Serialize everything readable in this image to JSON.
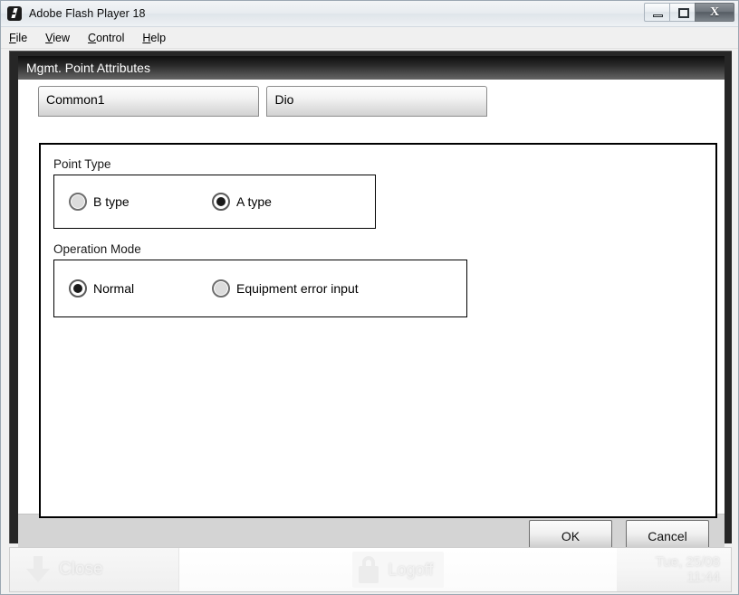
{
  "window": {
    "title": "Adobe Flash Player 18",
    "icon": "flash-icon",
    "controls": {
      "minimize": "minimize-icon",
      "maximize": "maximize-icon",
      "close": "X"
    }
  },
  "menubar": {
    "items": [
      {
        "label": "File",
        "accel": "F"
      },
      {
        "label": "View",
        "accel": "V"
      },
      {
        "label": "Control",
        "accel": "C"
      },
      {
        "label": "Help",
        "accel": "H"
      }
    ]
  },
  "dialog": {
    "title": "Mgmt. Point Attributes",
    "tabs": [
      {
        "label": "Common1",
        "selected": true
      },
      {
        "label": "Dio",
        "selected": false
      }
    ],
    "groups": [
      {
        "label": "Point Type",
        "options": [
          {
            "label": "B type",
            "selected": false
          },
          {
            "label": "A type",
            "selected": true
          }
        ]
      },
      {
        "label": "Operation Mode",
        "options": [
          {
            "label": "Normal",
            "selected": true
          },
          {
            "label": "Equipment error input",
            "selected": false
          }
        ]
      }
    ],
    "buttons": {
      "ok": "OK",
      "cancel": "Cancel"
    }
  },
  "appbar": {
    "close_label": "Close",
    "close_icon": "down-arrow-icon",
    "logoff_label": "Logoff",
    "logoff_icon": "lock-icon",
    "clock_date": "Tue, 25/08",
    "clock_time": "11:44"
  },
  "colors": {
    "dialog_header_dark": "#0e0e0e",
    "stage_frame": "#262626",
    "footer_bg": "#d4d4d4",
    "radio_selected_dot": "#1a1a1a"
  }
}
